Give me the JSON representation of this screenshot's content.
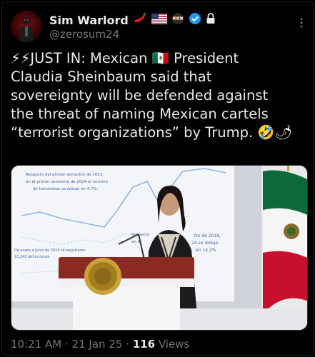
{
  "author": {
    "display_name": "Sim Warlord",
    "handle": "@zerosum24",
    "name_emojis": [
      "hot-pepper-icon",
      "us-flag-icon",
      "ninja-icon"
    ],
    "verified_color": "#1d9bf0"
  },
  "post": {
    "lines": [
      "⚡⚡JUST IN: Mexican 🇲🇽 President",
      "Claudia Sheinbaum said that",
      "sovereignty will be defended against",
      "the threat of naming Mexican cartels",
      "“terrorist organizations” by Trump. 🤣🌶"
    ]
  },
  "media": {
    "slide_text": {
      "top_left_1": "Respecto del primer semestre de 2023,",
      "top_left_2": "en el primer semestre de 2024 el número",
      "top_left_3": "de homicidios se redujo en 4.7%.",
      "mid_left_1": "Respecto",
      "mid_left_2": "en el",
      "bottom_left_1": "De enero a junio de 2024 se registraron",
      "bottom_left_2": "13,240 defunciones",
      "right_1": "tre de 2018,",
      "right_2": "24 se redujo",
      "right_3": "en 14.2%."
    }
  },
  "meta": {
    "time": "10:21 AM",
    "separator": "·",
    "date": "21 Jan 25",
    "views_count": "116",
    "views_label": "Views"
  }
}
